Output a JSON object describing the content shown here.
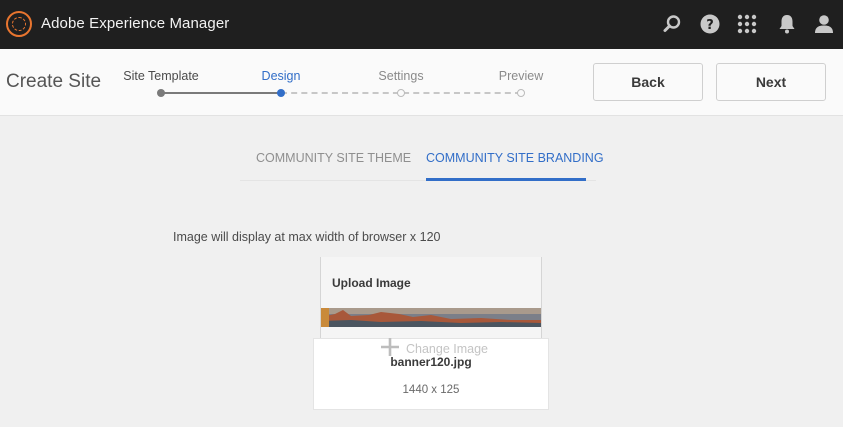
{
  "app": {
    "title": "Adobe Experience Manager"
  },
  "topbar_icons": [
    "search-icon",
    "help-icon",
    "apps-grid-icon",
    "notifications-bell-icon",
    "user-icon"
  ],
  "wizard": {
    "title": "Create Site",
    "steps": [
      {
        "label": "Site Template",
        "state": "done"
      },
      {
        "label": "Design",
        "state": "active"
      },
      {
        "label": "Settings",
        "state": "todo"
      },
      {
        "label": "Preview",
        "state": "todo"
      }
    ],
    "back_label": "Back",
    "next_label": "Next"
  },
  "tabs": [
    {
      "label": "COMMUNITY SITE THEME",
      "active": false
    },
    {
      "label": "COMMUNITY SITE BRANDING",
      "active": true
    }
  ],
  "branding": {
    "hint": "Image will display at max width of browser x 120",
    "upload_title": "Upload Image",
    "change_label": "Change Image",
    "file_name": "banner120.jpg",
    "file_dims": "1440 x 125"
  },
  "colors": {
    "accent": "#326ec8",
    "topbar": "#1f1f1f",
    "brand": "#e8752f"
  }
}
